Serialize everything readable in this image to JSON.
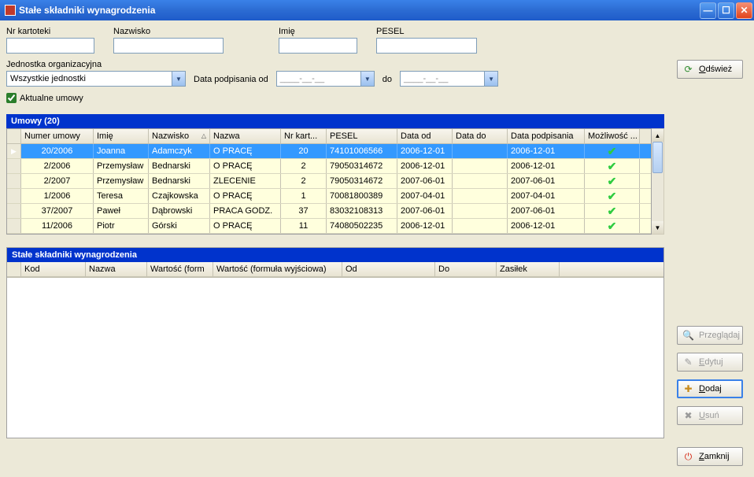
{
  "titlebar": {
    "title": "Stałe składniki wynagrodzenia"
  },
  "filters": {
    "nr_kartoteki_label": "Nr kartoteki",
    "nazwisko_label": "Nazwisko",
    "imie_label": "Imię",
    "pesel_label": "PESEL",
    "jednostka_label": "Jednostka organizacyjna",
    "jednostka_value": "Wszystkie jednostki",
    "data_podpisania_label": "Data podpisania  od",
    "date_od": "____-__-__",
    "date_do_label": "do",
    "date_do": "____-__-__",
    "aktualne_label": "Aktualne umowy"
  },
  "buttons": {
    "odswiez": "Odśwież",
    "przegladaj": "Przeglądaj",
    "edytuj": "Edytuj",
    "dodaj": "Dodaj",
    "usun": "Usuń",
    "zamknij": "Zamknij"
  },
  "umowy": {
    "header": "Umowy (20)",
    "columns": {
      "numer": "Numer umowy",
      "imie": "Imię",
      "nazwisko": "Nazwisko",
      "nazwa": "Nazwa",
      "nrkart": "Nr kart...",
      "pesel": "PESEL",
      "data_od": "Data od",
      "data_do": "Data do",
      "data_podp": "Data podpisania",
      "mozl": "Możliwość ..."
    },
    "rows": [
      {
        "numer": "20/2006",
        "imie": "Joanna",
        "nazwisko": "Adamczyk",
        "nazwa": "O PRACĘ",
        "nrkart": "20",
        "pesel": "74101006566",
        "data_od": "2006-12-01",
        "data_do": "",
        "data_podp": "2006-12-01",
        "mozl": true,
        "selected": true
      },
      {
        "numer": "2/2006",
        "imie": "Przemysław",
        "nazwisko": "Bednarski",
        "nazwa": "O PRACĘ",
        "nrkart": "2",
        "pesel": "79050314672",
        "data_od": "2006-12-01",
        "data_do": "",
        "data_podp": "2006-12-01",
        "mozl": true
      },
      {
        "numer": "2/2007",
        "imie": "Przemysław",
        "nazwisko": "Bednarski",
        "nazwa": "ZLECENIE",
        "nrkart": "2",
        "pesel": "79050314672",
        "data_od": "2007-06-01",
        "data_do": "",
        "data_podp": "2007-06-01",
        "mozl": true
      },
      {
        "numer": "1/2006",
        "imie": "Teresa",
        "nazwisko": "Czajkowska",
        "nazwa": "O PRACĘ",
        "nrkart": "1",
        "pesel": "70081800389",
        "data_od": "2007-04-01",
        "data_do": "",
        "data_podp": "2007-04-01",
        "mozl": true
      },
      {
        "numer": "37/2007",
        "imie": "Paweł",
        "nazwisko": "Dąbrowski",
        "nazwa": "PRACA GODZ.",
        "nrkart": "37",
        "pesel": "83032108313",
        "data_od": "2007-06-01",
        "data_do": "",
        "data_podp": "2007-06-01",
        "mozl": true
      },
      {
        "numer": "11/2006",
        "imie": "Piotr",
        "nazwisko": "Górski",
        "nazwa": "O PRACĘ",
        "nrkart": "11",
        "pesel": "74080502235",
        "data_od": "2006-12-01",
        "data_do": "",
        "data_podp": "2006-12-01",
        "mozl": true
      }
    ]
  },
  "skladniki": {
    "header": "Stałe składniki wynagrodzenia",
    "columns": {
      "kod": "Kod",
      "nazwa": "Nazwa",
      "wf1": "Wartość (form",
      "wf2": "Wartość (formuła wyjściowa)",
      "od": "Od",
      "do": "Do",
      "zasilek": "Zasiłek"
    }
  }
}
